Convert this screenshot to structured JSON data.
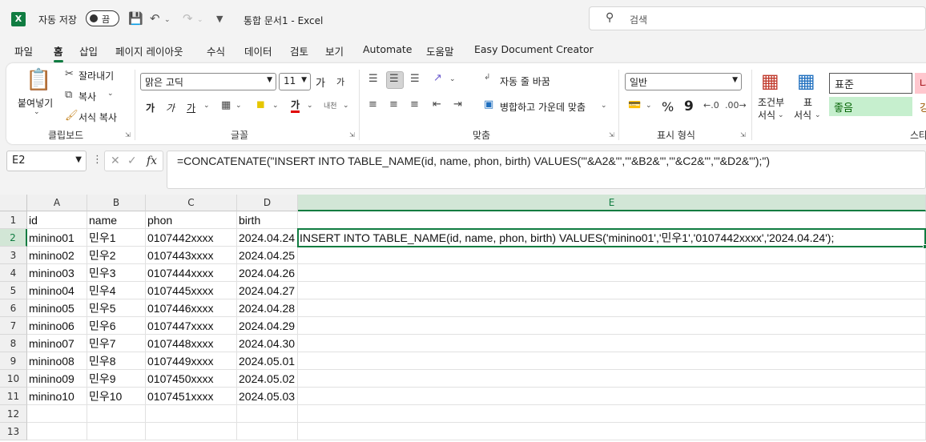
{
  "titlebar": {
    "autosave_label": "자동 저장",
    "autosave_state": "끔",
    "doc_title": "통합 문서1  -  Excel",
    "search_placeholder": "검색"
  },
  "tabs": [
    "파일",
    "홈",
    "삽입",
    "페이지 레이아웃",
    "수식",
    "데이터",
    "검토",
    "보기",
    "Automate",
    "도움말",
    "Easy Document Creator"
  ],
  "active_tab": "홈",
  "ribbon": {
    "clipboard": {
      "label": "클립보드",
      "paste": "붙여넣기",
      "cut": "잘라내기",
      "copy": "복사",
      "format_painter": "서식 복사"
    },
    "font": {
      "label": "글꼴",
      "font_name": "맑은 고딕",
      "font_size": "11",
      "grow": "가",
      "shrink": "가",
      "bold": "가",
      "italic": "가",
      "underline": "가",
      "font_color": "가",
      "phonetic": "내천"
    },
    "alignment": {
      "label": "맞춤",
      "wrap_text": "자동 줄 바꿈",
      "merge_center": "병합하고 가운데 맞춤"
    },
    "number": {
      "label": "표시 형식",
      "format": "일반",
      "percent": "%",
      "comma": "9"
    },
    "styles": {
      "conditional": "조건부\n서식",
      "conditional_l1": "조건부",
      "conditional_l2": "서식",
      "table_l1": "표",
      "table_l2": "서식",
      "normal": "표준",
      "good": "좋음",
      "bad": "나",
      "neutral": "강",
      "label": "스타"
    }
  },
  "formula_bar": {
    "name_box": "E2",
    "fx": "fx",
    "formula": "=CONCATENATE(\"INSERT INTO TABLE_NAME(id, name, phon, birth) VALUES('\"&A2&\"','\"&B2&\"','\"&C2&\"','\"&D2&\"');\")"
  },
  "sheet": {
    "columns": [
      "A",
      "B",
      "C",
      "D",
      "E"
    ],
    "rows": [
      "1",
      "2",
      "3",
      "4",
      "5",
      "6",
      "7",
      "8",
      "9",
      "10",
      "11",
      "12",
      "13"
    ],
    "data": [
      [
        "id",
        "name",
        "phon",
        "birth",
        ""
      ],
      [
        "minino01",
        "민우1",
        "0107442xxxx",
        "2024.04.24",
        "INSERT INTO TABLE_NAME(id, name, phon, birth) VALUES('minino01','민우1','0107442xxxx','2024.04.24');"
      ],
      [
        "minino02",
        "민우2",
        "0107443xxxx",
        "2024.04.25",
        ""
      ],
      [
        "minino03",
        "민우3",
        "0107444xxxx",
        "2024.04.26",
        ""
      ],
      [
        "minino04",
        "민우4",
        "0107445xxxx",
        "2024.04.27",
        ""
      ],
      [
        "minino05",
        "민우5",
        "0107446xxxx",
        "2024.04.28",
        ""
      ],
      [
        "minino06",
        "민우6",
        "0107447xxxx",
        "2024.04.29",
        ""
      ],
      [
        "minino07",
        "민우7",
        "0107448xxxx",
        "2024.04.30",
        ""
      ],
      [
        "minino08",
        "민우8",
        "0107449xxxx",
        "2024.05.01",
        ""
      ],
      [
        "minino09",
        "민우9",
        "0107450xxxx",
        "2024.05.02",
        ""
      ],
      [
        "minino10",
        "민우10",
        "0107451xxxx",
        "2024.05.03",
        ""
      ],
      [
        "",
        "",
        "",
        "",
        ""
      ],
      [
        "",
        "",
        "",
        "",
        ""
      ]
    ],
    "selected_column": "E",
    "selected_row": "2"
  },
  "colors": {
    "accent": "#107c41",
    "good_bg": "#c6efce",
    "good_fg": "#006100",
    "bad_bg": "#ffc7ce",
    "bad_fg": "#9c0006"
  }
}
